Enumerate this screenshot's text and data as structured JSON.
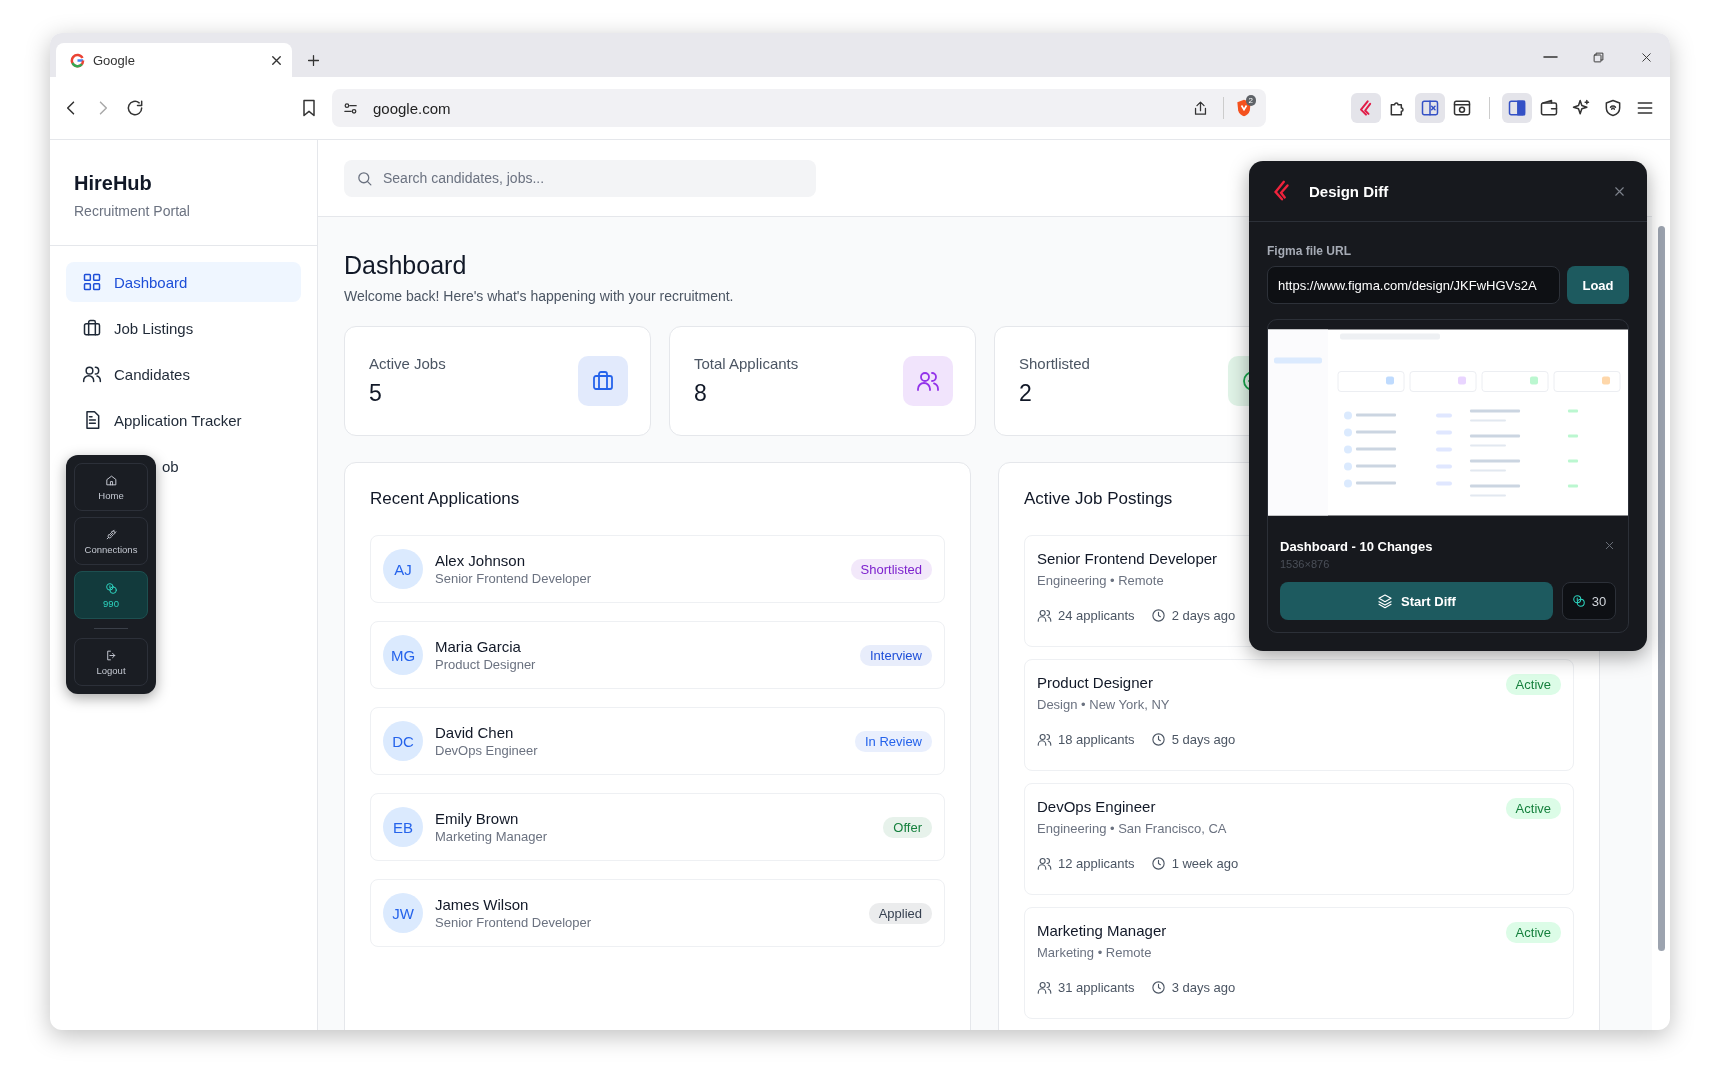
{
  "browser": {
    "tab": {
      "title": "Google",
      "selected": true
    },
    "address": "google.com",
    "shield_badge": "2"
  },
  "sidebar": {
    "brand": "HireHub",
    "subtitle": "Recruitment Portal",
    "items": [
      {
        "label": "Dashboard",
        "selected": true
      },
      {
        "label": "Job Listings",
        "selected": false
      },
      {
        "label": "Candidates",
        "selected": false
      },
      {
        "label": "Application Tracker",
        "selected": false
      },
      {
        "label": "ob",
        "selected": false
      }
    ]
  },
  "dock": {
    "items": [
      {
        "label": "Home",
        "selected": false
      },
      {
        "label": "Connections",
        "selected": false
      },
      {
        "label": "990",
        "selected": true
      },
      {
        "label": "Logout",
        "selected": false
      }
    ]
  },
  "search": {
    "placeholder": "Search candidates, jobs..."
  },
  "page": {
    "title": "Dashboard",
    "subtitle": "Welcome back! Here's what's happening with your recruitment."
  },
  "stats": [
    {
      "label": "Active Jobs",
      "value": "5"
    },
    {
      "label": "Total Applicants",
      "value": "8"
    },
    {
      "label": "Shortlisted",
      "value": "2"
    }
  ],
  "recent": {
    "title": "Recent Applications",
    "rows": [
      {
        "initials": "AJ",
        "name": "Alex Johnson",
        "role": "Senior Frontend Developer",
        "status": "Shortlisted",
        "color": "#7e22ce"
      },
      {
        "initials": "MG",
        "name": "Maria Garcia",
        "role": "Product Designer",
        "status": "Interview",
        "color": "#1d4ed8"
      },
      {
        "initials": "DC",
        "name": "David Chen",
        "role": "DevOps Engineer",
        "status": "In Review",
        "color": "#2563eb"
      },
      {
        "initials": "EB",
        "name": "Emily Brown",
        "role": "Marketing Manager",
        "status": "Offer",
        "color": "#15803d"
      },
      {
        "initials": "JW",
        "name": "James Wilson",
        "role": "Senior Frontend Developer",
        "status": "Applied",
        "color": "#374151"
      }
    ]
  },
  "jobs": {
    "title": "Active Job Postings",
    "rows": [
      {
        "title": "Senior Frontend Developer",
        "meta": "Engineering • Remote",
        "applicants": "24 applicants",
        "posted": "2 days ago"
      },
      {
        "title": "Product Designer",
        "meta": "Design • New York, NY",
        "status": "Active",
        "applicants": "18 applicants",
        "posted": "5 days ago"
      },
      {
        "title": "DevOps Engineer",
        "meta": "Engineering • San Francisco, CA",
        "status": "Active",
        "applicants": "12 applicants",
        "posted": "1 week ago"
      },
      {
        "title": "Marketing Manager",
        "meta": "Marketing • Remote",
        "status": "Active",
        "applicants": "31 applicants",
        "posted": "3 days ago"
      }
    ]
  },
  "diff_panel": {
    "title": "Design Diff",
    "url_label": "Figma file URL",
    "url": "https://www.figma.com/design/JKFwHGVs2A",
    "load": "Load",
    "preview": {
      "title": "Dashboard - 10 Changes",
      "size": "1536×876"
    },
    "start": "Start Diff",
    "credits": "30"
  }
}
